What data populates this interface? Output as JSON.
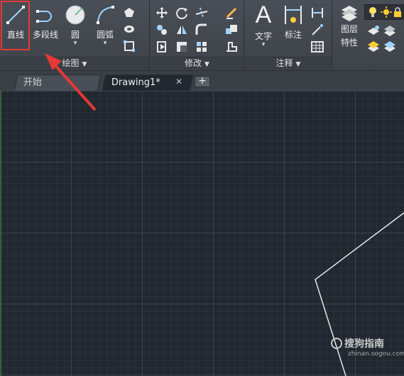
{
  "ribbon": {
    "draw_panel": {
      "title": "绘图",
      "tools": {
        "line": "直线",
        "polyline": "多段线",
        "circle": "圆",
        "arc": "圆弧"
      }
    },
    "modify_panel": {
      "title": "修改"
    },
    "annotation_panel": {
      "title": "注释",
      "tools": {
        "text": "文字",
        "dimension": "标注"
      }
    },
    "layers_panel": {
      "tool_line1": "图层",
      "tool_line2": "特性"
    }
  },
  "tabs": [
    {
      "label": "开始"
    },
    {
      "label": "Drawing1*"
    }
  ],
  "tab_close": "✕",
  "tab_add": "+",
  "watermark": {
    "main": "搜狗指南",
    "sub": "zhinan.sogou.com"
  },
  "colors": {
    "highlight": "#e53935",
    "arrow": "#e53935",
    "canvas": "#212830",
    "ribbon": "#43484f"
  }
}
